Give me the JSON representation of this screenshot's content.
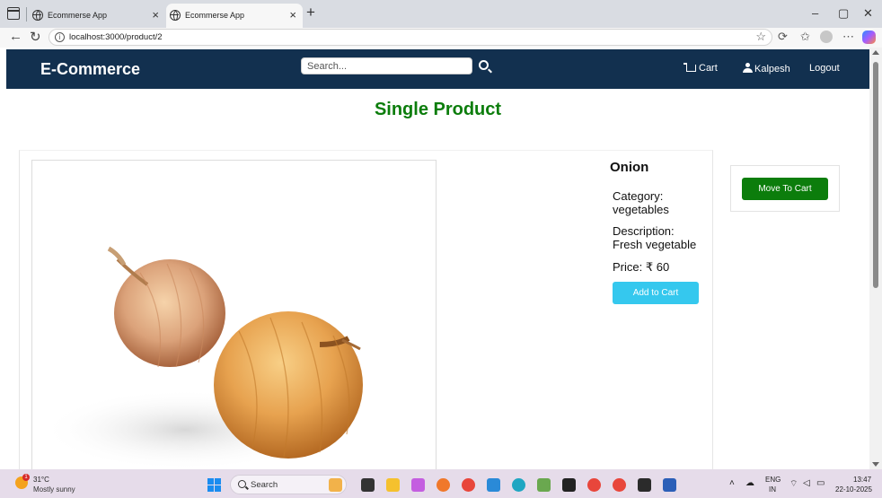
{
  "browser": {
    "tabs": [
      {
        "title": "Ecommerse App",
        "active": false
      },
      {
        "title": "Ecommerse App",
        "active": true
      }
    ],
    "new_tab": "+",
    "url": "localhost:3000/product/2",
    "window_controls": {
      "minimize": "–",
      "maximize": "▢",
      "close": "✕"
    }
  },
  "navbar": {
    "brand": "E-Commerce",
    "search_placeholder": "Search...",
    "cart_label": "Cart",
    "user_label": "Kalpesh",
    "logout_label": "Logout"
  },
  "page": {
    "heading": "Single Product"
  },
  "product": {
    "name": "Onion",
    "category_label": "Category:",
    "category_value": "vegetables",
    "description_label": "Description:",
    "description_value": "Fresh vegetable",
    "price_text": "Price: ₹ 60",
    "add_button": "Add to Cart",
    "move_button": "Move To Cart"
  },
  "taskbar": {
    "temperature": "31°C",
    "weather": "Mostly sunny",
    "weather_badge": "1",
    "search_label": "Search",
    "lang": "ENG",
    "region": "IN",
    "time": "13:47",
    "date": "22-10-2025"
  },
  "colors": {
    "navbar": "#12304f",
    "heading_green": "#0c7d0c",
    "add_button": "#35c8ee",
    "move_button": "#0c7d0c"
  }
}
